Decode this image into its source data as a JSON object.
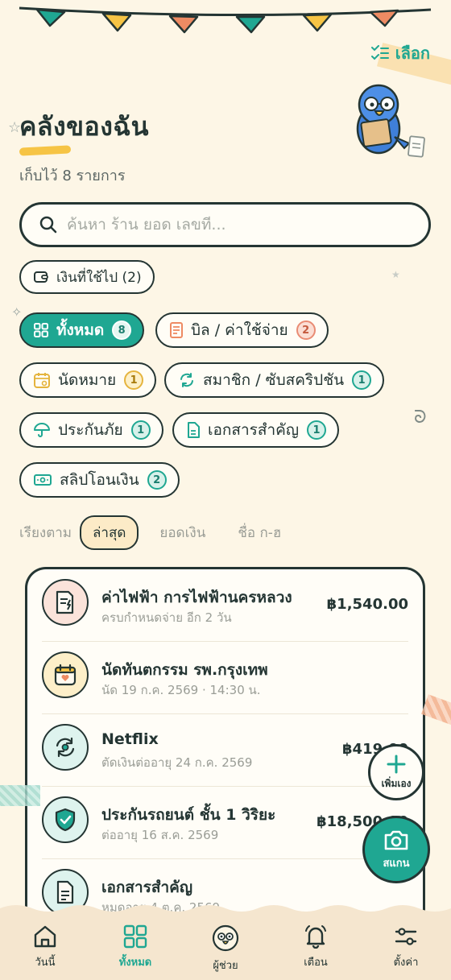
{
  "header": {
    "select_label": "เลือก",
    "title": "คลังของฉัน",
    "subtitle": "เก็บไว้ 8 รายการ"
  },
  "search": {
    "placeholder": "ค้นหา ร้าน ยอด เลขที่..."
  },
  "spent_chip": {
    "label": "เงินที่ใช้ไป (2)"
  },
  "filters": [
    {
      "label": "ทั้งหมด",
      "count": "8",
      "icon": "grid-icon"
    },
    {
      "label": "บิล / ค่าใช้จ่าย",
      "count": "2",
      "icon": "bill-icon"
    },
    {
      "label": "นัดหมาย",
      "count": "1",
      "icon": "calendar-icon"
    },
    {
      "label": "สมาชิก / ซับสคริปชัน",
      "count": "1",
      "icon": "refresh-icon"
    },
    {
      "label": "ประกันภัย",
      "count": "1",
      "icon": "umbrella-icon"
    },
    {
      "label": "เอกสารสำคัญ",
      "count": "1",
      "icon": "document-icon"
    },
    {
      "label": "สลิปโอนเงิน",
      "count": "2",
      "icon": "cash-icon"
    }
  ],
  "sort": {
    "label": "เรียงตาม",
    "options": [
      "ล่าสุด",
      "ยอดเงิน",
      "ชื่อ ก-ฮ"
    ],
    "selected": "ล่าสุด"
  },
  "items": [
    {
      "title": "ค่าไฟฟ้า การไฟฟ้านครหลวง",
      "sub": "ครบกำหนดจ่าย อีก 2 วัน",
      "amount": "฿1,540.00",
      "icon": "bill-icon"
    },
    {
      "title": "นัดทันตกรรม รพ.กรุงเทพ",
      "sub": "นัด 19 ก.ค. 2569 · 14:30 น.",
      "amount": "",
      "icon": "calendar-heart-icon"
    },
    {
      "title": "Netflix",
      "sub": "ตัดเงินต่ออายุ 24 ก.ค. 2569",
      "amount": "฿419.00",
      "icon": "subscription-icon"
    },
    {
      "title": "ประกันรถยนต์ ชั้น 1 วิริยะ",
      "sub": "ต่ออายุ 16 ส.ค. 2569",
      "amount": "฿18,500.00",
      "icon": "shield-check-icon"
    },
    {
      "title": "เอกสารสำคัญ",
      "sub": "หมดอายุ 4 ต.ค. 2569",
      "amount": "",
      "icon": "document-icon"
    }
  ],
  "fab": {
    "add_label": "เพิ่มเอง",
    "scan_label": "สแกน"
  },
  "nav": [
    {
      "label": "วันนี้",
      "icon": "home-icon"
    },
    {
      "label": "ทั้งหมด",
      "icon": "grid-icon"
    },
    {
      "label": "ผู้ช่วย",
      "icon": "parrot-icon"
    },
    {
      "label": "เตือน",
      "icon": "bell-icon"
    },
    {
      "label": "ตั้งค่า",
      "icon": "sliders-icon"
    }
  ],
  "colors": {
    "accent": "#1fa792",
    "ink": "#243533",
    "background": "#fdf6e6"
  }
}
